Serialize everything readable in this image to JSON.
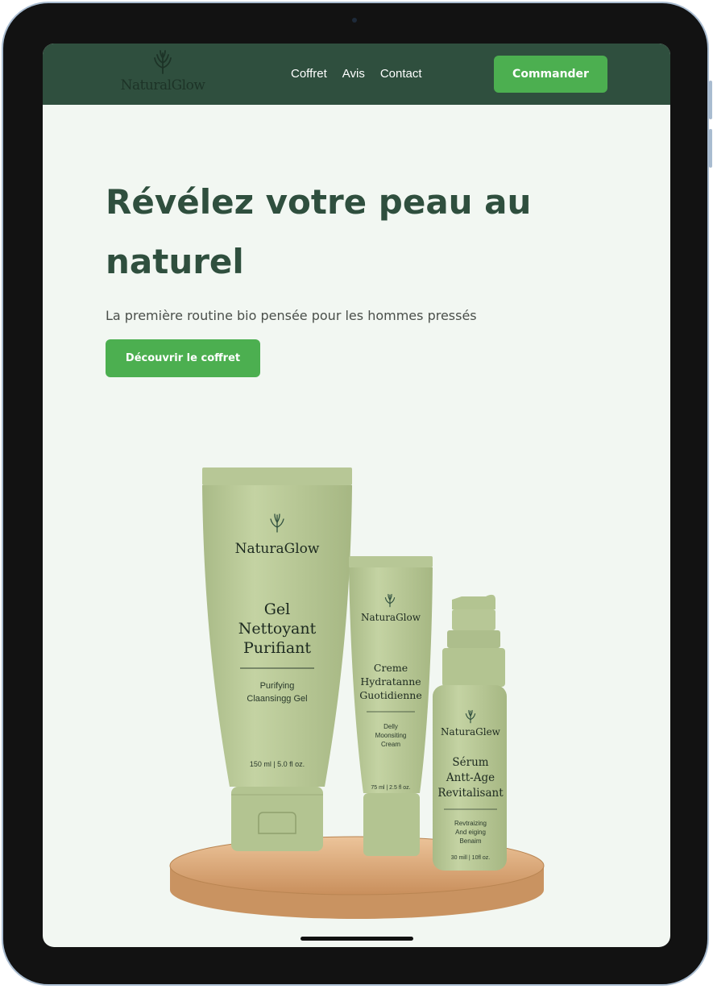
{
  "brand": {
    "name": "NaturalGlow",
    "icon": "leaf-icon",
    "color": "#1d3327"
  },
  "nav": {
    "links": [
      "Coffret",
      "Avis",
      "Contact"
    ],
    "cta": "Commander",
    "background": "#2f4f3e"
  },
  "hero": {
    "title": "Révélez votre peau au naturel",
    "subtitle": "La première routine bio pensée pour les hommes pressés",
    "cta": "Découvrir le coffret",
    "accent": "#4caf50",
    "title_color": "#2f4f3e"
  },
  "products": {
    "gel": {
      "brand": "NaturaGlow",
      "name_lines": [
        "Gel",
        "Nettoyant",
        "Purifiant"
      ],
      "desc_lines": [
        "Purifying",
        "Claansingg Gel"
      ],
      "volume": "150 ml | 5.0 fl oz."
    },
    "cream": {
      "brand": "NaturaGlow",
      "name_lines": [
        "Creme",
        "Hydratanne",
        "Guotidienne"
      ],
      "desc_lines": [
        "Delly",
        "Moonsiting",
        "Cream"
      ],
      "volume": "75 ml | 2.5 fl oz."
    },
    "serum": {
      "brand": "NaturaGlew",
      "name_lines": [
        "Sérum",
        "Antt-Age",
        "Revitalisant"
      ],
      "desc_lines": [
        "Revtraizing",
        "And eiging",
        "Benaim"
      ],
      "volume": "30 mill | 10fl oz."
    }
  }
}
